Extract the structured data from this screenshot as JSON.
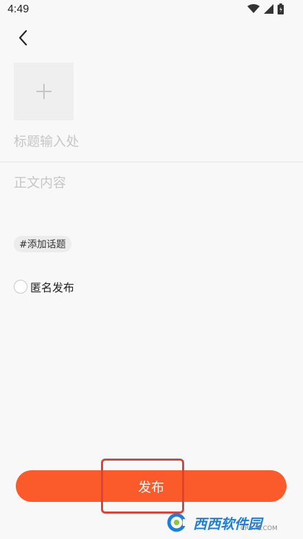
{
  "status_bar": {
    "time": "4:49",
    "icons": [
      "wifi-icon",
      "signal-icon",
      "battery-icon"
    ]
  },
  "header": {
    "back_icon": "chevron-left-icon"
  },
  "editor": {
    "add_image_icon": "plus-icon",
    "title_placeholder": "标题输入处",
    "body_placeholder": "正文内容",
    "topic_label": "#添加话题",
    "anonymous_label": "匿名发布"
  },
  "footer": {
    "publish_label": "发布",
    "accent_color": "#fb5a2a"
  },
  "watermark": {
    "text": "西西软件园",
    "url": "CR173.COM"
  }
}
